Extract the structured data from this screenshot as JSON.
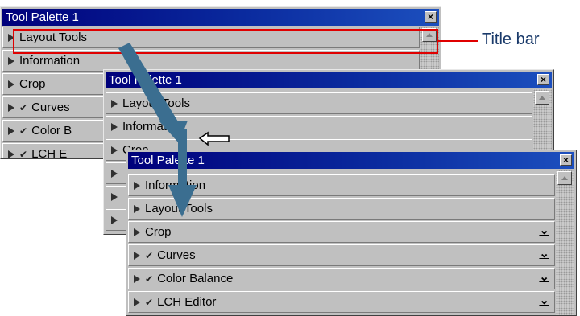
{
  "colors": {
    "titlebar": "#00007b",
    "highlight": "#e00000",
    "arrow": "#3b6e90",
    "callout_text": "#1a3a6a"
  },
  "callout": {
    "label": "Title bar"
  },
  "palette1": {
    "title": "Tool Palette 1",
    "close": "×",
    "rows": [
      {
        "label": "Layout Tools",
        "checked": false
      },
      {
        "label": "Information",
        "checked": false
      },
      {
        "label": "Crop",
        "checked": false
      },
      {
        "label": "Curves",
        "checked": true
      },
      {
        "label": "Color B",
        "checked": true
      },
      {
        "label": "LCH E",
        "checked": true
      }
    ]
  },
  "palette2": {
    "title": "Tool Palette 1",
    "close": "×",
    "rows": [
      {
        "label": "Layout Tools",
        "checked": false
      },
      {
        "label": "Information",
        "checked": false
      },
      {
        "label": "Crop",
        "checked": false
      }
    ]
  },
  "palette3": {
    "title": "Tool Palette 1",
    "close": "×",
    "rows": [
      {
        "label": "Information",
        "checked": false,
        "collapse": false
      },
      {
        "label": "Layout Tools",
        "checked": false,
        "collapse": false
      },
      {
        "label": "Crop",
        "checked": false,
        "collapse": true
      },
      {
        "label": "Curves",
        "checked": true,
        "collapse": true
      },
      {
        "label": "Color Balance",
        "checked": true,
        "collapse": true
      },
      {
        "label": "LCH Editor",
        "checked": true,
        "collapse": true
      }
    ]
  },
  "icons": {
    "expand": "expand-triangle-icon",
    "check": "check-icon",
    "collapse": "collapse-icon",
    "close": "close-icon",
    "scroll_up": "scroll-up-arrow-icon",
    "drag_cursor": "hand-pointer-icon",
    "drag_arrow": "drag-arrow-icon"
  }
}
